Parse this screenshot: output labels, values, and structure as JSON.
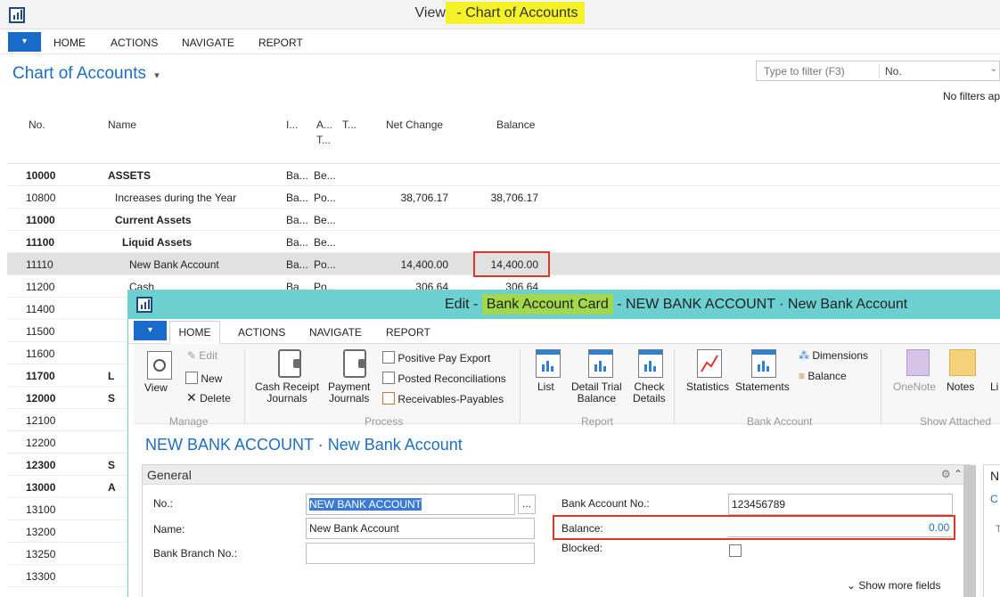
{
  "back": {
    "title_prefix": "View",
    "title_dash": " - ",
    "title_highlight": "Chart of Accounts",
    "app_menu": "▾",
    "tabs": [
      "HOME",
      "ACTIONS",
      "NAVIGATE",
      "REPORT"
    ],
    "page_title": "Chart of Accounts",
    "page_title_chevron": "▾",
    "filter": {
      "placeholder": "Type to filter (F3)",
      "field": "No.",
      "chevron": "⌄"
    },
    "no_filters": "No filters applied",
    "columns": {
      "no": "No.",
      "name": "Name",
      "i": "I...",
      "a": "A...",
      "a2": "T...",
      "t": "T...",
      "net": "Net Change",
      "bal": "Balance"
    },
    "rows": [
      {
        "no": "10000",
        "name": "ASSETS",
        "i": "Ba...",
        "a": "Be...",
        "net": "",
        "bal": "",
        "bold": true,
        "indent": 0
      },
      {
        "no": "10800",
        "name": "Increases during the Year",
        "i": "Ba...",
        "a": "Po...",
        "net": "38,706.17",
        "bal": "38,706.17",
        "bold": false,
        "indent": 1
      },
      {
        "no": "11000",
        "name": "Current Assets",
        "i": "Ba...",
        "a": "Be...",
        "net": "",
        "bal": "",
        "bold": true,
        "indent": 1
      },
      {
        "no": "11100",
        "name": "Liquid Assets",
        "i": "Ba...",
        "a": "Be...",
        "net": "",
        "bal": "",
        "bold": true,
        "indent": 2
      },
      {
        "no": "11110",
        "name": "New Bank Account",
        "i": "Ba...",
        "a": "Po...",
        "net": "14,400.00",
        "bal": "14,400.00",
        "bold": false,
        "indent": 3,
        "selected": true
      },
      {
        "no": "11200",
        "name": "Cash",
        "i": "Ba...",
        "a": "Po...",
        "net": "306.64",
        "bal": "306.64",
        "bold": false,
        "indent": 3
      },
      {
        "no": "11400",
        "name": "",
        "bold": false
      },
      {
        "no": "11500",
        "name": "",
        "bold": false
      },
      {
        "no": "11600",
        "name": "",
        "bold": false
      },
      {
        "no": "11700",
        "name": "L",
        "bold": true
      },
      {
        "no": "12000",
        "name": "S",
        "bold": true
      },
      {
        "no": "12100",
        "name": "",
        "bold": false
      },
      {
        "no": "12200",
        "name": "",
        "bold": false
      },
      {
        "no": "12300",
        "name": "S",
        "bold": true
      },
      {
        "no": "13000",
        "name": "A",
        "bold": true
      },
      {
        "no": "13100",
        "name": "",
        "bold": false
      },
      {
        "no": "13200",
        "name": "",
        "bold": false
      },
      {
        "no": "13250",
        "name": "",
        "bold": false
      },
      {
        "no": "13300",
        "name": "",
        "bold": false
      }
    ]
  },
  "front": {
    "title_prefix": "Edit - ",
    "title_highlight": "Bank Account Card",
    "title_suffix": " - NEW BANK ACCOUNT · New Bank Account",
    "tabs": [
      "HOME",
      "ACTIONS",
      "NAVIGATE",
      "REPORT"
    ],
    "ribbon": {
      "view": "View",
      "edit": "Edit",
      "new": "New",
      "delete": "Delete",
      "manage": "Manage",
      "cash_receipt": [
        "Cash Receipt",
        "Journals"
      ],
      "payment": [
        "Payment",
        "Journals"
      ],
      "positive_pay": "Positive Pay Export",
      "posted_recon": "Posted Reconciliations",
      "recv_pay": "Receivables-Payables",
      "process": "Process",
      "list": "List",
      "detail_trial": [
        "Detail Trial",
        "Balance"
      ],
      "check_details": [
        "Check",
        "Details"
      ],
      "report": "Report",
      "statistics": "Statistics",
      "statements": "Statements",
      "dimensions": "Dimensions",
      "balance": "Balance",
      "bank_account": "Bank Account",
      "onenote": "OneNote",
      "notes": "Notes",
      "links": "Li",
      "show_attached": "Show Attached"
    },
    "card_title": "NEW BANK ACCOUNT · New Bank Account",
    "general": {
      "header": "General",
      "collapse": "⌃",
      "no_label": "No.:",
      "no_value": "NEW BANK ACCOUNT",
      "ellipsis": "...",
      "name_label": "Name:",
      "name_value": "New Bank Account",
      "branch_label": "Bank Branch No.:",
      "branch_value": "",
      "acct_label": "Bank Account No.:",
      "acct_value": "123456789",
      "bal_label": "Balance:",
      "bal_value": "0.00",
      "blocked_label": "Blocked:",
      "show_more": "Show more fields",
      "show_more_chev": "⌄",
      "side_n": "N",
      "side_c": "C",
      "side_t": "T"
    }
  }
}
